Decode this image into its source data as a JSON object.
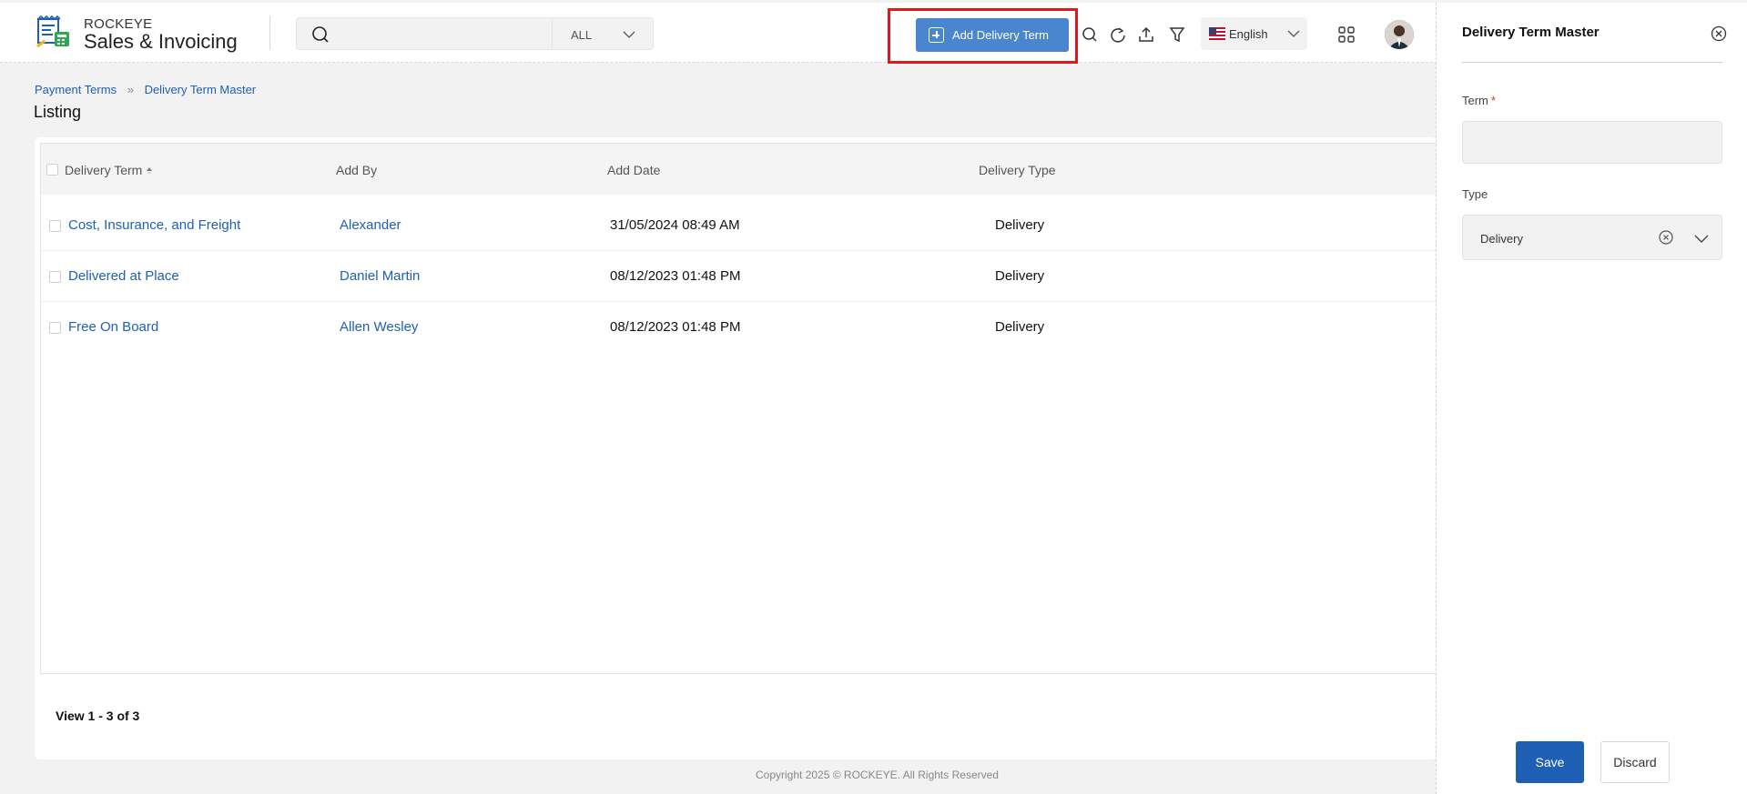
{
  "colors": {
    "accent": "#4a86d0",
    "primary": "#1e5fb4",
    "link": "#1f5fb7",
    "highlight": "#e8131b"
  },
  "header": {
    "brand_top": "ROCKEYE",
    "brand_main": "Sales & Invoicing",
    "search": {
      "value": "",
      "placeholder": ""
    },
    "scope": "ALL",
    "add_button_label": "Add Delivery Term",
    "toolbar_icons": [
      "search-icon",
      "refresh-icon",
      "upload-icon",
      "filter-icon"
    ],
    "language": "English"
  },
  "breadcrumb": {
    "items": [
      "Payment Terms",
      "Delivery Term Master"
    ]
  },
  "page_title": "Listing",
  "table": {
    "columns": [
      "Delivery Term",
      "Add By",
      "Add Date",
      "Delivery Type"
    ],
    "rows": [
      {
        "term": "Cost, Insurance, and Freight",
        "add_by": "Alexander",
        "add_date": "31/05/2024 08:49 AM",
        "type": "Delivery"
      },
      {
        "term": "Delivered at Place",
        "add_by": "Daniel Martin",
        "add_date": "08/12/2023 01:48 PM",
        "type": "Delivery"
      },
      {
        "term": "Free On Board",
        "add_by": "Allen Wesley",
        "add_date": "08/12/2023 01:48 PM",
        "type": "Delivery"
      }
    ],
    "view_count": "View 1 - 3 of 3"
  },
  "footer": {
    "copyright": "Copyright 2025 © ROCKEYE. All Rights Reserved"
  },
  "panel": {
    "title": "Delivery Term Master",
    "term_label": "Term",
    "term_required": "*",
    "term_value": "",
    "type_label": "Type",
    "type_value": "Delivery",
    "save_label": "Save",
    "discard_label": "Discard"
  }
}
